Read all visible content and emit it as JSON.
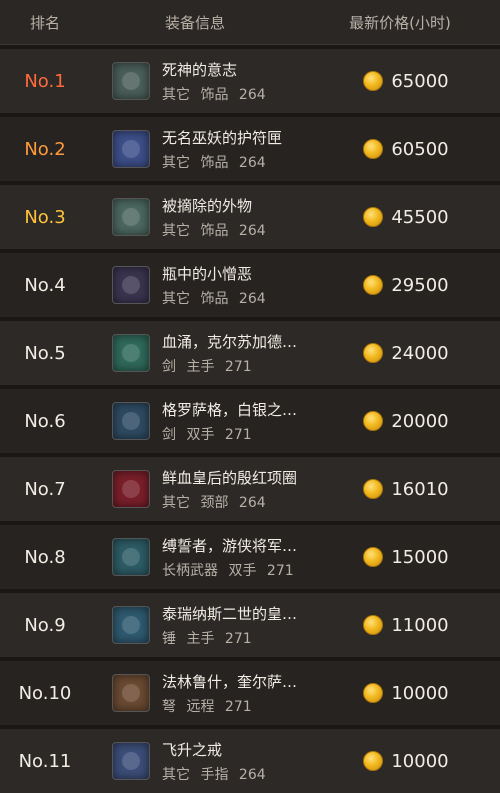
{
  "header": {
    "rank": "排名",
    "item": "装备信息",
    "price": "最新价格(小时)"
  },
  "colors": {
    "rank1": "#ff6a3d",
    "rank2": "#ff9a3d",
    "rank3": "#ffc23a",
    "rank_default": "#f1ece4"
  },
  "rows": [
    {
      "rank": "No.1",
      "name": "死神的意志",
      "meta": [
        "其它",
        "饰品",
        "264"
      ],
      "price": "65000",
      "icon": "gear-orb-icon",
      "iconColor": "#4b5f5a"
    },
    {
      "rank": "No.2",
      "name": "无名巫妖的护符匣",
      "meta": [
        "其它",
        "饰品",
        "264"
      ],
      "price": "60500",
      "icon": "spike-gem-icon",
      "iconColor": "#3d4f8a"
    },
    {
      "rank": "No.3",
      "name": "被摘除的外物",
      "meta": [
        "其它",
        "饰品",
        "264"
      ],
      "price": "45500",
      "icon": "armor-icon",
      "iconColor": "#4c6860"
    },
    {
      "rank": "No.4",
      "name": "瓶中的小憎恶",
      "meta": [
        "其它",
        "饰品",
        "264"
      ],
      "price": "29500",
      "icon": "bottle-icon",
      "iconColor": "#3b3450"
    },
    {
      "rank": "No.5",
      "name": "血涌，克尔苏加德…",
      "meta": [
        "剑",
        "主手",
        "271"
      ],
      "price": "24000",
      "icon": "sword-icon",
      "iconColor": "#2f6a5a"
    },
    {
      "rank": "No.6",
      "name": "格罗萨格，白银之…",
      "meta": [
        "剑",
        "双手",
        "271"
      ],
      "price": "20000",
      "icon": "greatsword-icon",
      "iconColor": "#2e4b63"
    },
    {
      "rank": "No.7",
      "name": "鲜血皇后的殷红项圈",
      "meta": [
        "其它",
        "颈部",
        "264"
      ],
      "price": "16010",
      "icon": "ruby-necklace-icon",
      "iconColor": "#7a1f2a"
    },
    {
      "rank": "No.8",
      "name": "缚誓者，游侠将军…",
      "meta": [
        "长柄武器",
        "双手",
        "271"
      ],
      "price": "15000",
      "icon": "polearm-icon",
      "iconColor": "#2d5c66"
    },
    {
      "rank": "No.9",
      "name": "泰瑞纳斯二世的皇…",
      "meta": [
        "锤",
        "主手",
        "271"
      ],
      "price": "11000",
      "icon": "mace-icon",
      "iconColor": "#2f5a70"
    },
    {
      "rank": "No.10",
      "name": "法林鲁什，奎尔萨…",
      "meta": [
        "弩",
        "远程",
        "271"
      ],
      "price": "10000",
      "icon": "crossbow-icon",
      "iconColor": "#6b4a32"
    },
    {
      "rank": "No.11",
      "name": "飞升之戒",
      "meta": [
        "其它",
        "手指",
        "264"
      ],
      "price": "10000",
      "icon": "ring-icon",
      "iconColor": "#3c4e7a"
    }
  ]
}
